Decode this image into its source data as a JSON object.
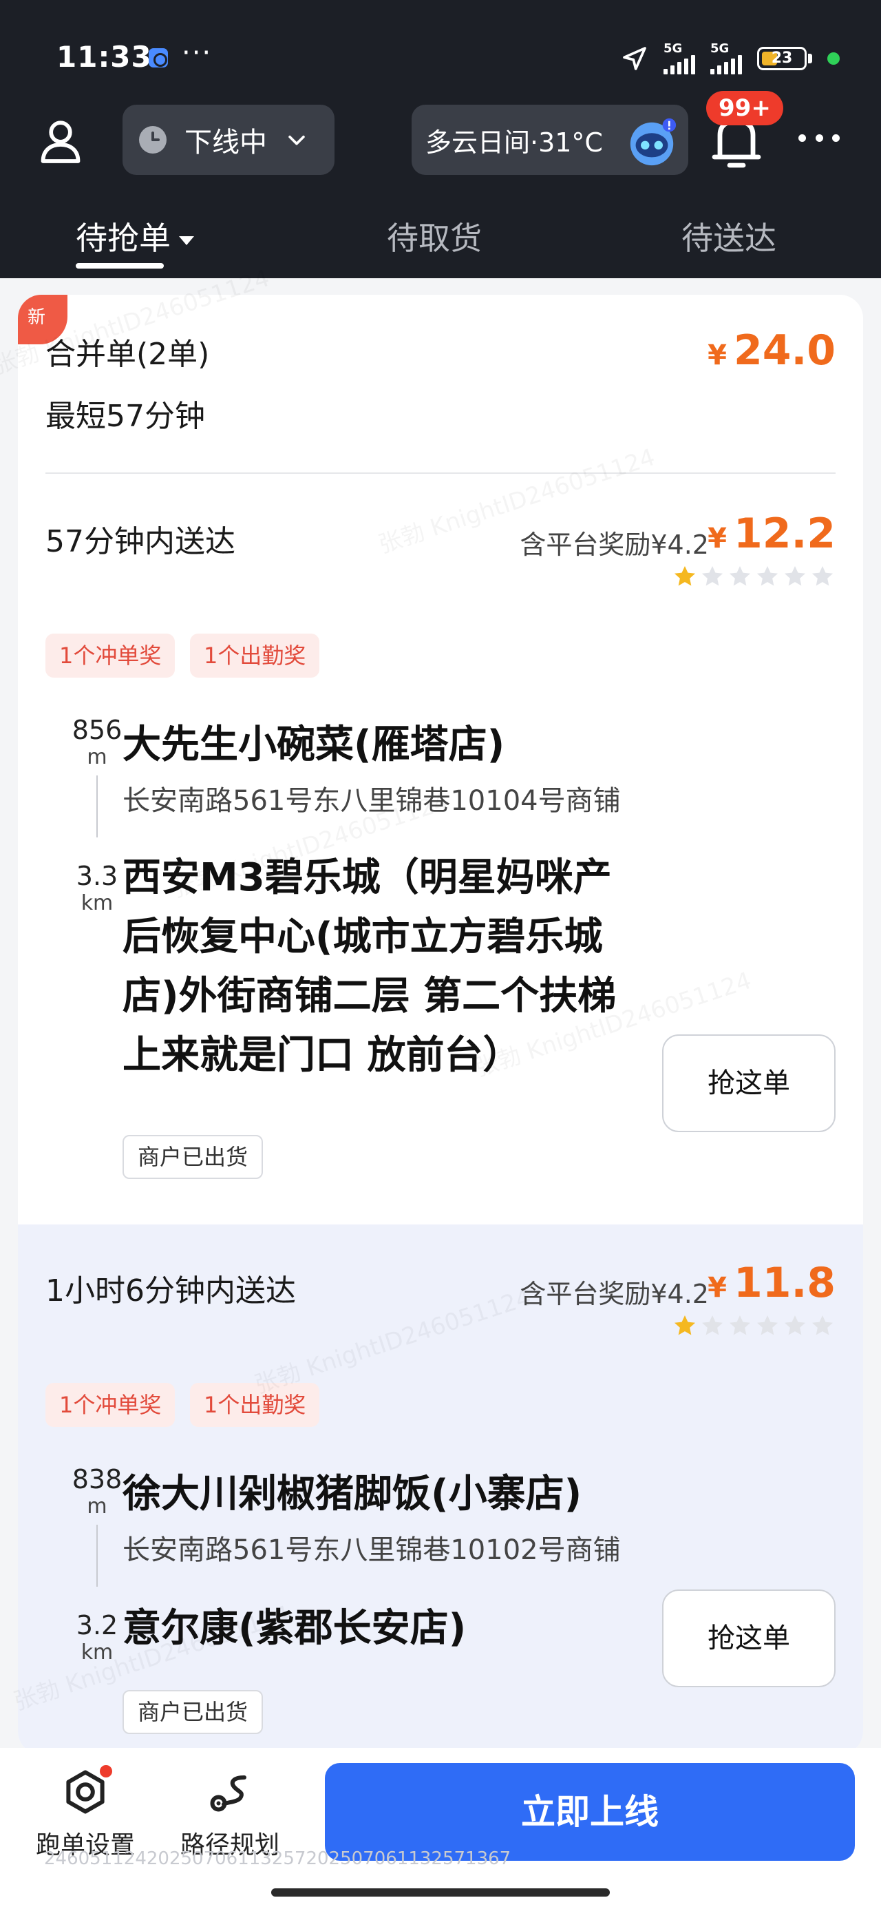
{
  "status_bar": {
    "time": "11:33",
    "dots": "···",
    "signal_1": "5G",
    "signal_2": "5G",
    "battery": "23"
  },
  "header": {
    "online_status": "下线中",
    "weather": "多云日间·31°C",
    "notification_badge": "99+"
  },
  "tabs": [
    {
      "label": "待抢单",
      "active": true
    },
    {
      "label": "待取货",
      "active": false
    },
    {
      "label": "待送达",
      "active": false
    }
  ],
  "watermark": "张勃 KnightID246051124",
  "combined_order": {
    "new_tag": "新",
    "title": "合并单(2单)",
    "subtitle": "最短57分钟",
    "currency": "¥",
    "total": "24.0"
  },
  "orders": [
    {
      "deadline": "57分钟内送达",
      "reward_note": "含平台奖励¥4.2",
      "currency": "¥",
      "price": "12.2",
      "rating": 1,
      "rating_max": 6,
      "tags": [
        "1个冲单奖",
        "1个出勤奖"
      ],
      "pickup_distance": "856",
      "pickup_unit": "m",
      "shop_name": "大先生小碗菜(雁塔店)",
      "shop_address": "长安南路561号东八里锦巷10104号商铺",
      "delivery_distance": "3.3",
      "delivery_unit": "km",
      "destination": "西安M3碧乐城（明星妈咪产后恢复中心(城市立方碧乐城店)外街商铺二层 第二个扶梯上来就是门口 放前台）",
      "status_chip": "商户已出货",
      "grab_label": "抢这单"
    },
    {
      "deadline": "1小时6分钟内送达",
      "reward_note": "含平台奖励¥4.2",
      "currency": "¥",
      "price": "11.8",
      "rating": 1,
      "rating_max": 6,
      "tags": [
        "1个冲单奖",
        "1个出勤奖"
      ],
      "pickup_distance": "838",
      "pickup_unit": "m",
      "shop_name": "徐大川剁椒猪脚饭(小寨店)",
      "shop_address": "长安南路561号东八里锦巷10102号商铺",
      "delivery_distance": "3.2",
      "delivery_unit": "km",
      "destination": "意尔康(紫郡长安店)",
      "status_chip": "商户已出货",
      "grab_label": "抢这单"
    }
  ],
  "bottom_bar": {
    "settings_label": "跑单设置",
    "route_label": "路径规划",
    "online_button": "立即上线",
    "footer_id": "24605112420250706113257202507061132571367"
  },
  "colors": {
    "header_bg": "#1c1f26",
    "price": "#f06a1c",
    "tag_text": "#e24a3b",
    "primary_button": "#2f6cf6",
    "star": "#f5b820"
  }
}
